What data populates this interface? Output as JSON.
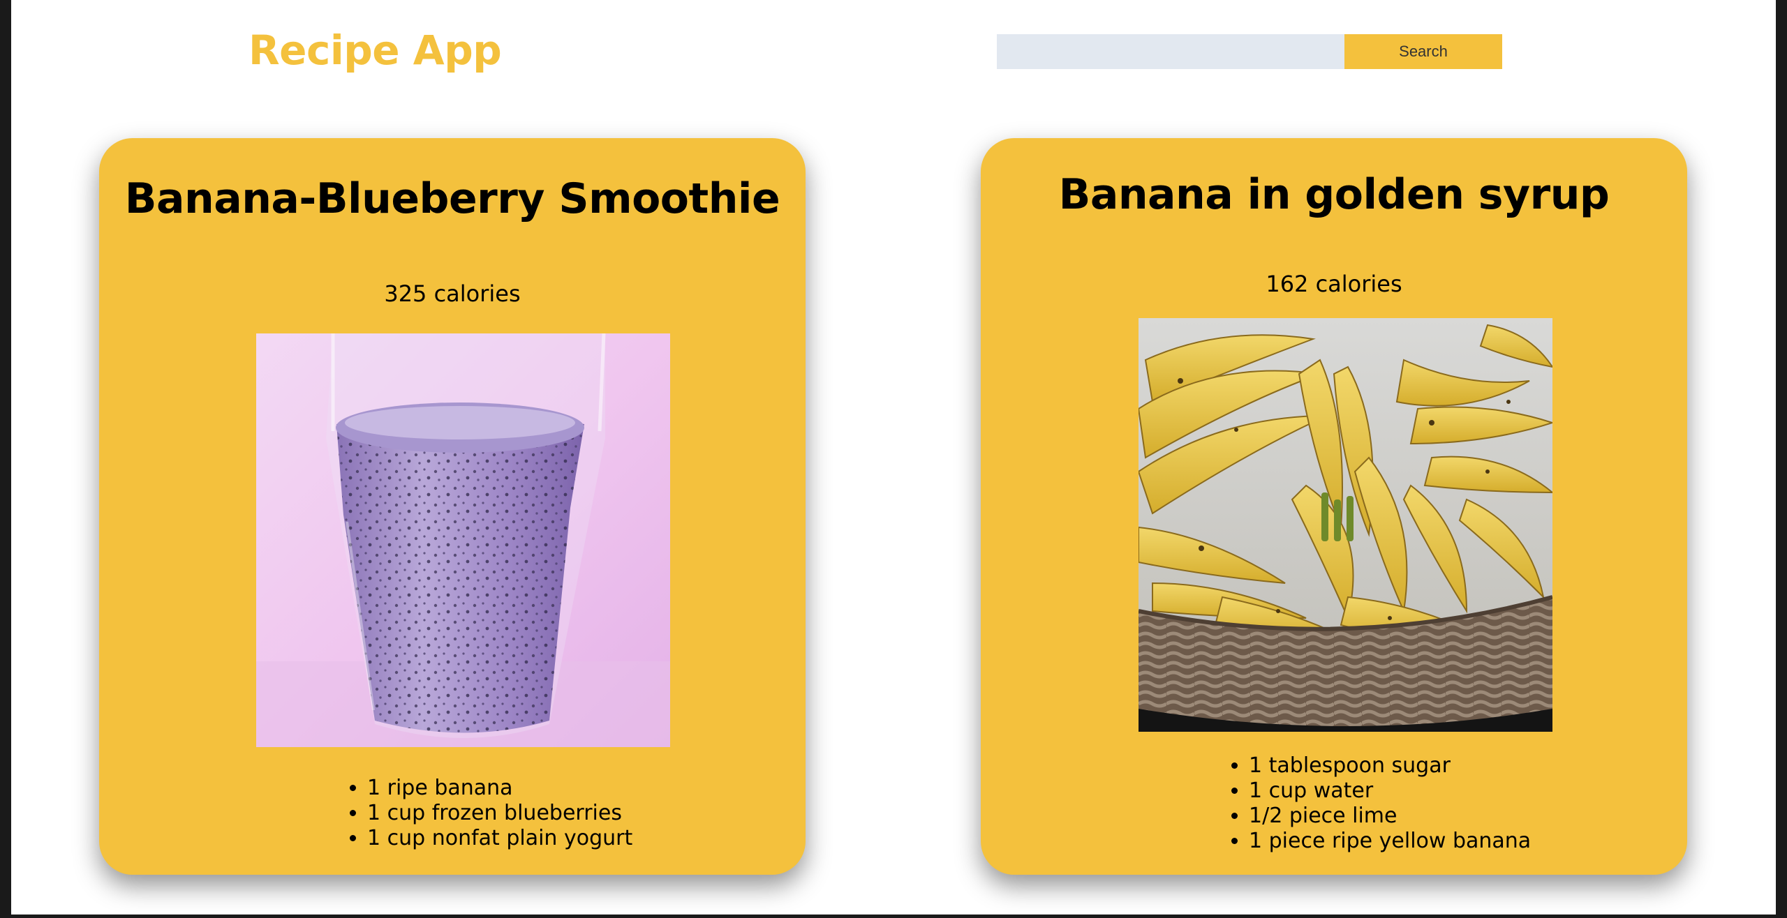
{
  "header": {
    "title": "Recipe App",
    "search_placeholder": "",
    "search_value": "",
    "search_button_label": "Search"
  },
  "recipes": [
    {
      "title": "Banana-Blueberry Smoothie",
      "calories": "325 calories",
      "image_icon": "smoothie-glass-photo",
      "ingredients": [
        "1 ripe banana",
        "1 cup frozen blueberries",
        "1 cup nonfat plain yogurt"
      ]
    },
    {
      "title": "Banana in golden syrup",
      "calories": "162 calories",
      "image_icon": "banana-basket-photo",
      "ingredients": [
        "1 tablespoon sugar",
        "1 cup water",
        "1/2 piece lime",
        "1 piece ripe yellow banana"
      ]
    }
  ],
  "colors": {
    "accent": "#f4c13d",
    "search_input_bg": "#e2e8f0",
    "page_bg": "#ffffff",
    "text": "#000000"
  }
}
